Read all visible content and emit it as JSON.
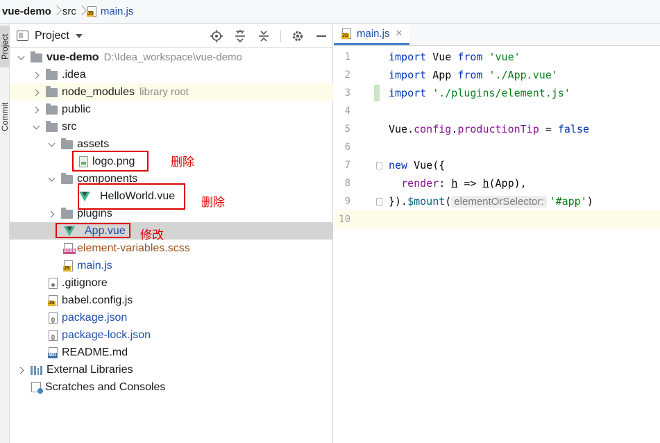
{
  "breadcrumb": {
    "project": "vue-demo",
    "folder": "src",
    "file": "main.js"
  },
  "tool_strip": {
    "project_tab": "Project",
    "commit_tab": "Commit"
  },
  "panel": {
    "title": "Project",
    "tools": [
      "locate-icon",
      "expand-all-icon",
      "collapse-all-icon",
      "gear-icon",
      "minimize-icon"
    ]
  },
  "tree": {
    "root": {
      "name": "vue-demo",
      "path": "D:\\Idea_workspace\\vue-demo"
    },
    "idea": ".idea",
    "node_modules": {
      "name": "node_modules",
      "note": "library root"
    },
    "public": "public",
    "src": "src",
    "assets": "assets",
    "logo": "logo.png",
    "components": "components",
    "helloworld": "HelloWorld.vue",
    "plugins": "plugins",
    "app_vue": "App.vue",
    "element_vars": "element-variables.scss",
    "main_js": "main.js",
    "gitignore": ".gitignore",
    "babel": "babel.config.js",
    "package": "package.json",
    "package_lock": "package-lock.json",
    "readme": "README.md",
    "external_libs": "External Libraries",
    "scratches": "Scratches and Consoles"
  },
  "annotations": {
    "delete_1": "删除",
    "delete_2": "删除",
    "modify": "修改"
  },
  "editor": {
    "tab": "main.js",
    "lines": [
      "1",
      "2",
      "3",
      "4",
      "5",
      "6",
      "7",
      "8",
      "9",
      "10"
    ],
    "code": {
      "l1": {
        "kw": "import",
        "id": " Vue ",
        "kw2": "from",
        "str": " 'vue'"
      },
      "l2": {
        "kw": "import",
        "id": " App ",
        "kw2": "from",
        "str": " './App.vue'"
      },
      "l3": {
        "kw": "import",
        "str": " './plugins/element.js'"
      },
      "l5": {
        "a": "Vue.",
        "b": "config",
        "c": ".",
        "d": "productionTip",
        "e": " = ",
        "f": "false"
      },
      "l7": {
        "kw": "new",
        "rest": " Vue({"
      },
      "l8": {
        "a": "  ",
        "b": "render",
        "c": ": ",
        "d": "h",
        "e": " => ",
        "f": "h",
        "g": "(App),"
      },
      "l9": {
        "a": "}).",
        "b": "$mount",
        "c": "(",
        "hint": "elementOrSelector:",
        "d": "'#app'",
        "e": ")"
      }
    }
  }
}
